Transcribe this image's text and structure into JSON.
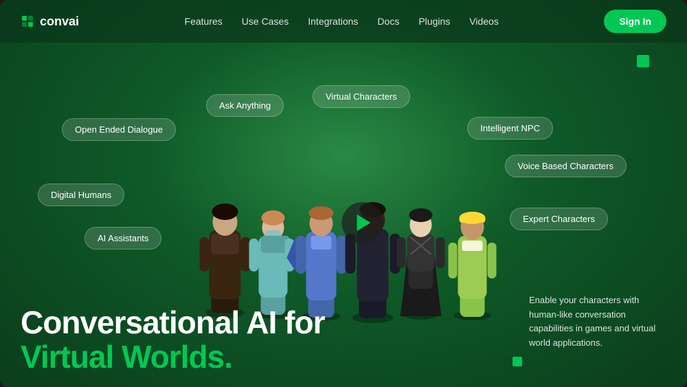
{
  "brand": {
    "name": "convai",
    "logo_icon": "grid-icon"
  },
  "navbar": {
    "links": [
      {
        "label": "Features",
        "id": "features"
      },
      {
        "label": "Use Cases",
        "id": "use-cases"
      },
      {
        "label": "Integrations",
        "id": "integrations"
      },
      {
        "label": "Docs",
        "id": "docs"
      },
      {
        "label": "Plugins",
        "id": "plugins"
      },
      {
        "label": "Videos",
        "id": "videos"
      }
    ],
    "sign_in_label": "Sign In"
  },
  "floating_tags": [
    {
      "id": "ask-anything",
      "label": "Ask Anything"
    },
    {
      "id": "virtual-characters",
      "label": "Virtual Characters"
    },
    {
      "id": "open-ended-dialogue",
      "label": "Open Ended Dialogue"
    },
    {
      "id": "intelligent-npc",
      "label": "Intelligent NPC"
    },
    {
      "id": "digital-humans",
      "label": "Digital Humans"
    },
    {
      "id": "voice-based-characters",
      "label": "Voice Based Characters"
    },
    {
      "id": "ai-assistants",
      "label": "AI Assistants"
    },
    {
      "id": "expert-characters",
      "label": "Expert Characters"
    }
  ],
  "hero": {
    "title_line1": "Conversational AI for",
    "title_line2": "Virtual Worlds.",
    "description": "Enable your characters with human-like conversation capabilities in games and virtual world applications."
  },
  "play_button": {
    "label": "Play video"
  },
  "colors": {
    "accent": "#00c853",
    "bg_dark": "#0a3d1c",
    "bg_mid": "#0f5a28"
  }
}
